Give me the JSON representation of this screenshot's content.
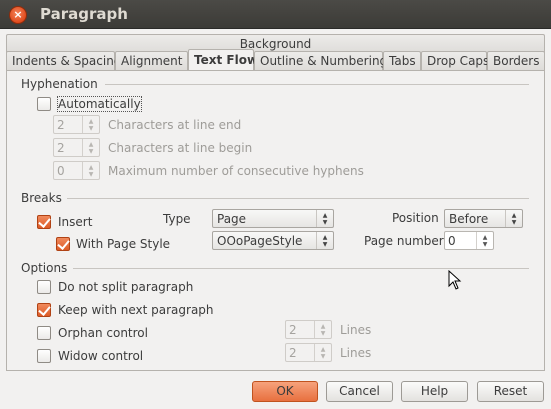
{
  "window": {
    "title": "Paragraph",
    "close_glyph": "×"
  },
  "tabs": {
    "row1": [
      "Background"
    ],
    "row2": [
      {
        "label": "Indents & Spacing",
        "active": false
      },
      {
        "label": "Alignment",
        "active": false
      },
      {
        "label": "Text Flow",
        "active": true
      },
      {
        "label": "Outline & Numbering",
        "active": false
      },
      {
        "label": "Tabs",
        "active": false
      },
      {
        "label": "Drop Caps",
        "active": false
      },
      {
        "label": "Borders",
        "active": false
      }
    ]
  },
  "hyphenation": {
    "heading": "Hyphenation",
    "automatically": {
      "label": "Automatically",
      "checked": false
    },
    "chars_line_end": {
      "value": "2",
      "label": "Characters at line end"
    },
    "chars_line_begin": {
      "value": "2",
      "label": "Characters at line begin"
    },
    "max_hyphens": {
      "value": "0",
      "label": "Maximum number of consecutive hyphens"
    }
  },
  "breaks": {
    "heading": "Breaks",
    "insert": {
      "label": "Insert",
      "checked": true
    },
    "type_label": "Type",
    "type_value": "Page",
    "position_label": "Position",
    "position_value": "Before",
    "with_page_style": {
      "label": "With Page Style",
      "checked": true
    },
    "page_style_value": "OOoPageStyle",
    "page_number_label": "Page number",
    "page_number_value": "0"
  },
  "options": {
    "heading": "Options",
    "do_not_split": {
      "label": "Do not split paragraph",
      "checked": false
    },
    "keep_with_next": {
      "label": "Keep with next paragraph",
      "checked": true
    },
    "orphan_control": {
      "label": "Orphan control",
      "checked": false,
      "value": "2",
      "unit": "Lines"
    },
    "widow_control": {
      "label": "Widow control",
      "checked": false,
      "value": "2",
      "unit": "Lines"
    }
  },
  "buttons": {
    "ok": "OK",
    "cancel": "Cancel",
    "help": "Help",
    "reset": "Reset"
  },
  "colors": {
    "accent": "#e8703f",
    "titlebar": "#3c3b37",
    "window_bg": "#f2f1f0"
  }
}
